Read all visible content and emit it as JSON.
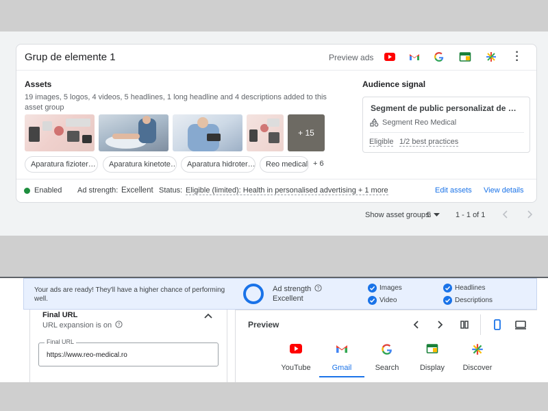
{
  "card": {
    "title": "Grup de elemente 1",
    "preview_ads": "Preview ads",
    "channel_icons": [
      "youtube-icon",
      "gmail-icon",
      "google-icon",
      "display-icon",
      "discover-icon"
    ]
  },
  "assets": {
    "title": "Assets",
    "description": "19 images, 5 logos, 4 videos, 5 headlines, 1 long headline and 4 descriptions added to this asset group",
    "more_images": "+ 15",
    "chips": [
      "Aparatura fizioter…",
      "Aparatura kinetote…",
      "Aparatura hidroter…",
      "Reo medical"
    ],
    "more_chips": "+ 6"
  },
  "audience": {
    "title": "Audience signal",
    "segment_title": "Segment de public personalizat de …",
    "segment_sub": "Segment Reo Medical",
    "eligible": "Eligible",
    "practices": "1/2 best practices"
  },
  "footer": {
    "enabled": "Enabled",
    "ad_strength_label": "Ad strength:",
    "ad_strength_value": "Excellent",
    "status_label": "Status:",
    "status_value": "Eligible (limited): Health in personalised advertising + 1 more",
    "edit_assets": "Edit assets",
    "view_details": "View details"
  },
  "pager": {
    "show_label": "Show asset groups:",
    "show_value": "5",
    "range": "1 - 1 of 1"
  },
  "banner": {
    "message": "Your ads are ready! They'll have a higher chance of performing well.",
    "ad_strength_label": "Ad strength",
    "ad_strength_value": "Excellent",
    "checks": [
      "Images",
      "Video",
      "Headlines",
      "Descriptions"
    ]
  },
  "final_url": {
    "title": "Final URL",
    "expansion": "URL expansion is on",
    "field_label": "Final URL",
    "field_value": "https://www.reo-medical.ro"
  },
  "preview": {
    "title": "Preview",
    "tabs": [
      "YouTube",
      "Gmail",
      "Search",
      "Display",
      "Discover"
    ],
    "active_tab": "Gmail"
  },
  "colors": {
    "accent": "#1a73e8",
    "enabled_dot": "#1e8e3e",
    "banner_bg": "#e8f0fe"
  }
}
